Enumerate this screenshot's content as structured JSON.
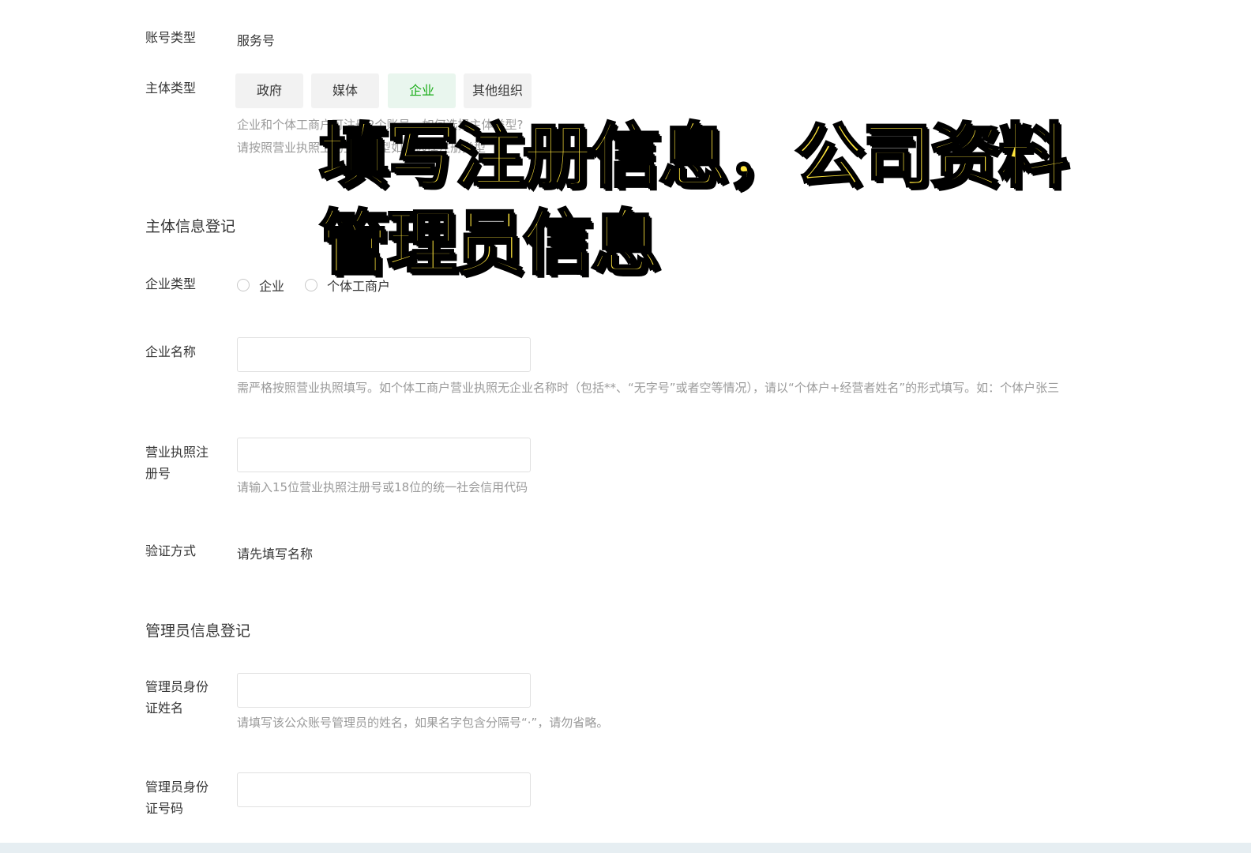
{
  "account_type": {
    "label": "账号类型",
    "value": "服务号"
  },
  "subject_type": {
    "label": "主体类型",
    "options": [
      "政府",
      "媒体",
      "企业",
      "其他组织"
    ],
    "selected": "企业",
    "hint_line1": "企业和个体工商户可注册2个账号，如何选择主体类型?",
    "hint_line2": "请按照营业执照上的主体类型如实选择注册类型"
  },
  "subject_section": {
    "title": "主体信息登记"
  },
  "enterprise_type": {
    "label": "企业类型",
    "options": [
      "企业",
      "个体工商户"
    ]
  },
  "enterprise_name": {
    "label": "企业名称",
    "value": "",
    "hint": "需严格按照营业执照填写。如个体工商户营业执照无企业名称时（包括**、“无字号”或者空等情况），请以“个体户+经营者姓名”的形式填写。如：个体户张三"
  },
  "license_number": {
    "label_line1": "营业执照注",
    "label_line2": "册号",
    "value": "",
    "hint": "请输入15位营业执照注册号或18位的统一社会信用代码"
  },
  "verification": {
    "label": "验证方式",
    "value": "请先填写名称"
  },
  "admin_section": {
    "title": "管理员信息登记"
  },
  "admin_name": {
    "label_line1": "管理员身份",
    "label_line2": "证姓名",
    "value": "",
    "hint": "请填写该公众账号管理员的姓名，如果名字包含分隔号“·”，请勿省略。"
  },
  "admin_id": {
    "label_line1": "管理员身份",
    "label_line2": "证号码",
    "value": ""
  },
  "overlay": {
    "line1": "填写注册信息，公司资料",
    "line2": "管理员信息"
  },
  "colors": {
    "accent": "#1aad19",
    "overlay_text": "#ffe53b"
  }
}
